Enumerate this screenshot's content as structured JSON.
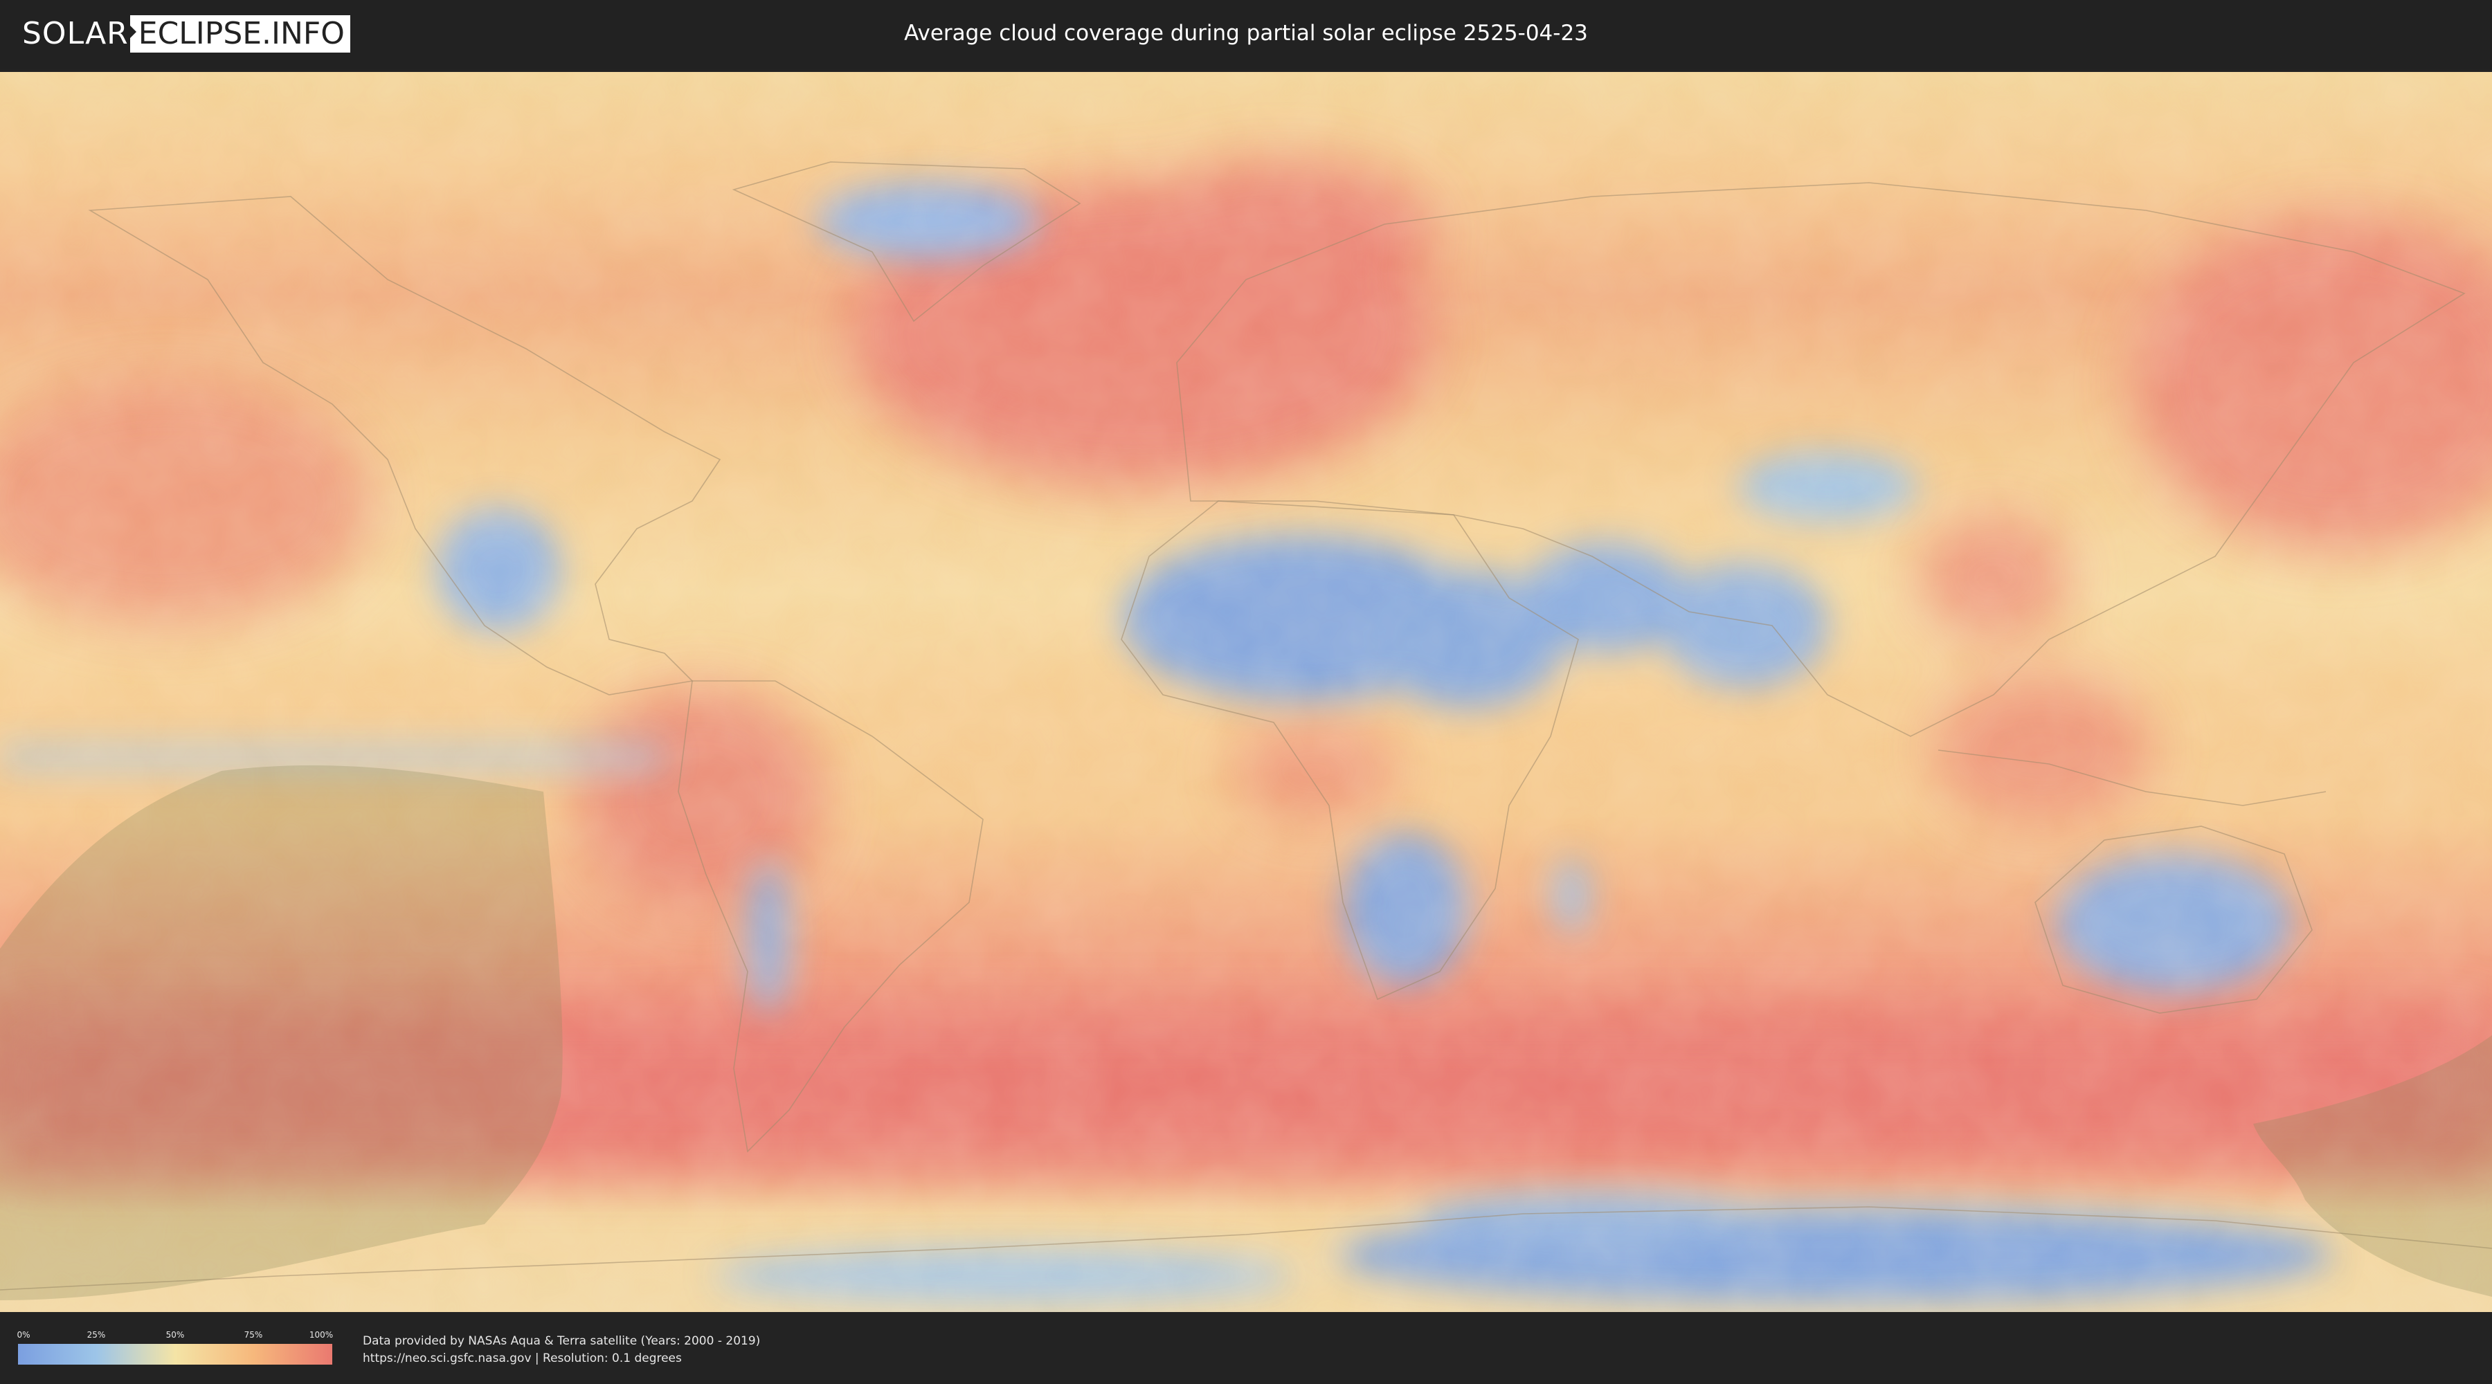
{
  "header": {
    "logo_solar": "SOLAR",
    "logo_eclipse": "ECLIPSE.INFO",
    "title": "Average cloud coverage during partial solar eclipse 2525-04-23"
  },
  "map": {
    "projection": "equirectangular",
    "layers": [
      "cloud-coverage-heatmap",
      "country-borders",
      "eclipse-visibility-zone"
    ],
    "eclipse_zone_color": "#8a8a5a"
  },
  "legend": {
    "ticks": [
      "0%",
      "25%",
      "50%",
      "75%",
      "100%"
    ],
    "colors": [
      "#7b9fe0",
      "#9dc5e8",
      "#f4e4a6",
      "#f6b87c",
      "#ea7970"
    ]
  },
  "footer": {
    "credit_line1": "Data provided by NASAs Aqua & Terra satellite (Years: 2000 - 2019)",
    "credit_line2": "https://neo.sci.gsfc.nasa.gov | Resolution: 0.1 degrees"
  },
  "colors": {
    "background": "#222222",
    "clear": "#7b9fe0",
    "cloudy": "#ea7970",
    "medium": "#f4d99a"
  }
}
